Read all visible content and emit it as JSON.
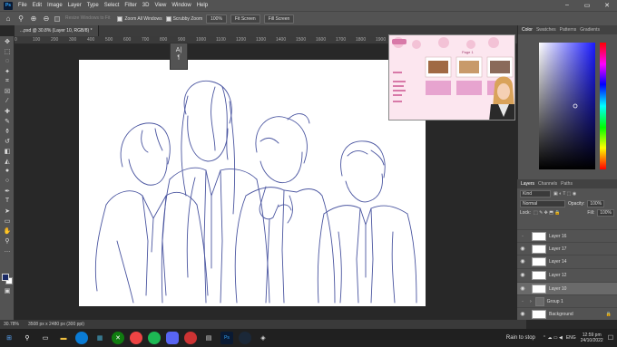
{
  "menubar": {
    "items": [
      "File",
      "Edit",
      "Image",
      "Layer",
      "Type",
      "Select",
      "Filter",
      "3D",
      "View",
      "Window",
      "Help"
    ]
  },
  "options": {
    "resize_windows": "Resize Windows to Fit",
    "zoom_all": "Zoom All Windows",
    "scrubby_zoom": "Scrubby Zoom",
    "zoom_pct": "100%",
    "fit_screen": "Fit Screen",
    "fill_screen": "Fill Screen"
  },
  "document": {
    "tab_title": "...psd @ 30.8% (Layer 10, RGB/8) *"
  },
  "ruler": {
    "ticks": [
      "0",
      "100",
      "200",
      "300",
      "400",
      "500",
      "600",
      "700",
      "800",
      "900",
      "1000",
      "1100",
      "1200",
      "1300",
      "1400",
      "1500",
      "1600",
      "1700",
      "1800",
      "1900",
      "2000",
      "2100",
      "2200",
      "2300",
      "2400"
    ]
  },
  "reference": {
    "header": "Page 1"
  },
  "color_panel": {
    "tabs": [
      "Color",
      "Swatches",
      "Patterns",
      "Gradients"
    ]
  },
  "layers_panel": {
    "tabs": [
      "Layers",
      "Channels",
      "Paths"
    ],
    "filter": "Kind",
    "blend_mode": "Normal",
    "opacity_label": "Opacity:",
    "opacity": "100%",
    "lock_label": "Lock:",
    "fill_label": "Fill:",
    "fill": "100%",
    "layers": [
      {
        "name": "Layer 16"
      },
      {
        "name": "Layer 17"
      },
      {
        "name": "Layer 14"
      },
      {
        "name": "Layer 12"
      },
      {
        "name": "Layer 10"
      },
      {
        "name": "Group 1"
      },
      {
        "name": "Background"
      }
    ]
  },
  "status": {
    "zoom": "30.78%",
    "size": "3508 px x 2480 px (300 ppi)"
  },
  "taskbar": {
    "weather": "Rain to stop",
    "lang": "ENG",
    "time": "12:59 pm",
    "date": "24/10/2022"
  }
}
